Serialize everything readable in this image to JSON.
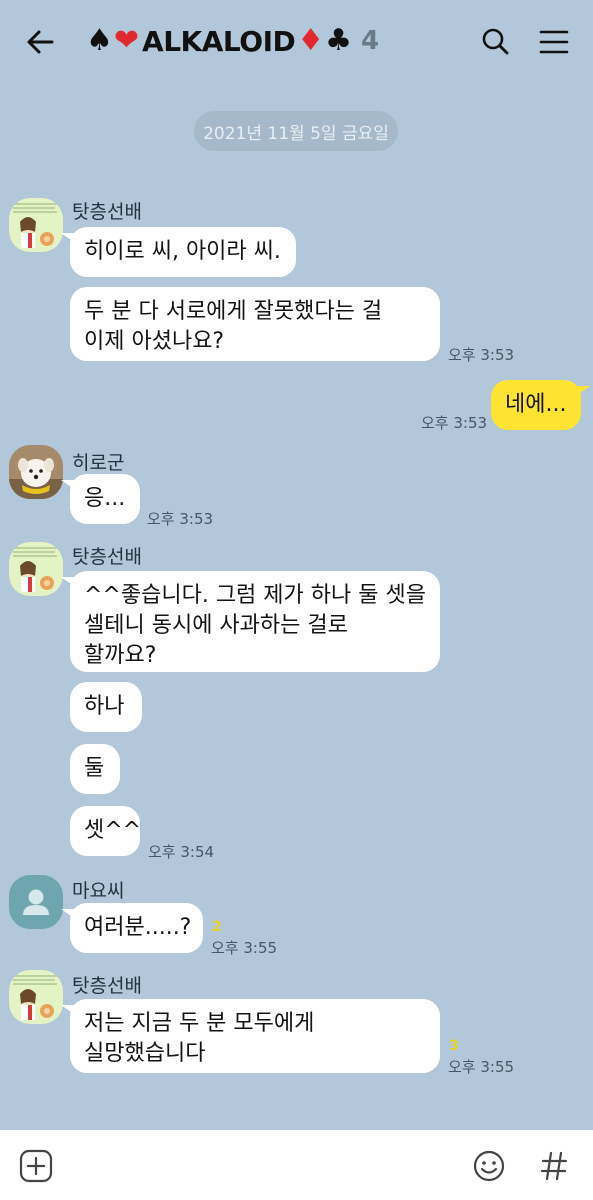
{
  "header": {
    "title": "ALKALOID",
    "member_count": "4",
    "suits": {
      "spade": "♠",
      "heart": "❤",
      "diamond": "♦",
      "club": "♣"
    }
  },
  "date_divider": "2021년 11월 5일 금요일",
  "messages": {
    "m1": {
      "sender": "탓층선배",
      "line1": "히이로 씨, 아이라 씨."
    },
    "m2": {
      "line1": "두 분 다 서로에게 잘못했다는 걸",
      "line2": "이제 아셨나요?",
      "time": "오후 3:53"
    },
    "m3": {
      "line1": "네에...",
      "time": "오후 3:53"
    },
    "m4": {
      "sender": "히로군",
      "line1": "응...",
      "time": "오후 3:53"
    },
    "m5": {
      "sender": "탓층선배",
      "line1": "^^좋습니다. 그럼 제가 하나 둘 셋을",
      "line2": "셀테니 동시에 사과하는 걸로",
      "line3": "할까요?"
    },
    "m6": {
      "line1": "하나"
    },
    "m7": {
      "line1": "둘"
    },
    "m8": {
      "line1": "셋^^",
      "time": "오후 3:54"
    },
    "m9": {
      "sender": "마요씨",
      "line1": "여러분.....?",
      "unread": "2",
      "time": "오후 3:55"
    },
    "m10": {
      "sender": "탓층선배",
      "line1": "저는 지금 두 분 모두에게",
      "line2": "실망했습니다",
      "unread": "3",
      "time": "오후 3:55"
    }
  },
  "colors": {
    "background": "#b2c7d9",
    "my_bubble": "#fde433",
    "other_bubble": "#ffffff",
    "unread_count": "#e8d320"
  },
  "icons": [
    "back-arrow-icon",
    "search-icon",
    "menu-icon",
    "add-icon",
    "emoji-icon",
    "hashtag-icon",
    "default-profile-icon"
  ]
}
